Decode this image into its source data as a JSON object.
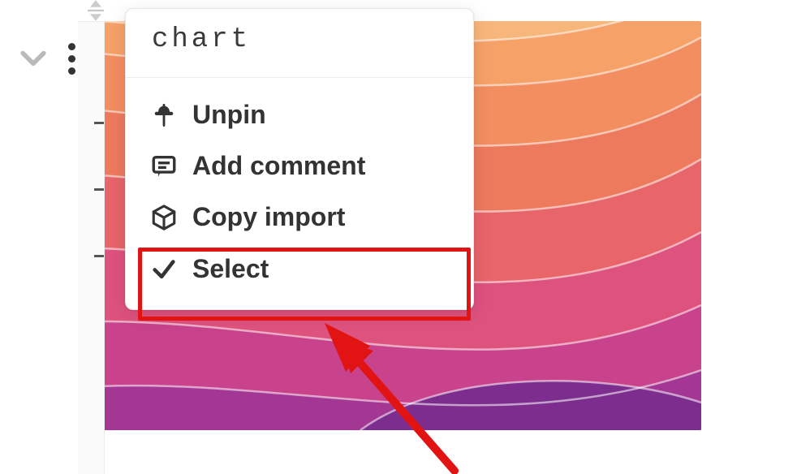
{
  "cell": {
    "name_input": "chart"
  },
  "menu": {
    "items": [
      {
        "label": "Unpin",
        "icon": "pin-icon"
      },
      {
        "label": "Add comment",
        "icon": "comment-icon"
      },
      {
        "label": "Copy import",
        "icon": "package-icon",
        "highlighted": true
      },
      {
        "label": "Select",
        "icon": "check-icon"
      }
    ]
  },
  "annotation": {
    "highlight_color": "#e11313"
  }
}
